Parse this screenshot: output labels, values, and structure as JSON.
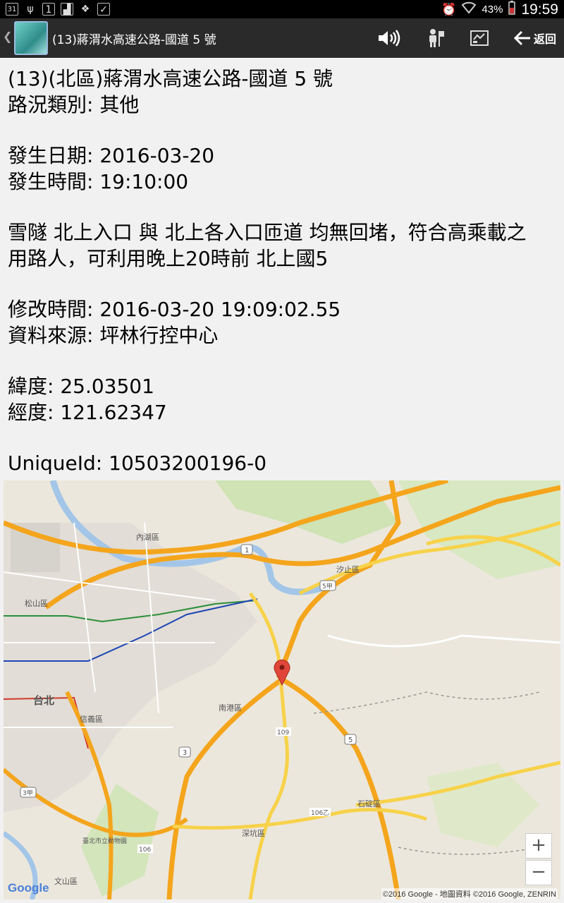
{
  "status_bar": {
    "battery_pct": "43%",
    "time": "19:59",
    "left_icons": [
      "calendar-icon",
      "usb-icon",
      "sim-icon",
      "image-icon",
      "dropbox-icon",
      "clipboard-icon"
    ],
    "calendar_day": "31",
    "sim_label": "1"
  },
  "action_bar": {
    "title": "(13)蔣渭水高速公路-國道 5 號",
    "back_label": "返回",
    "icons": [
      "volume-icon",
      "street-view-icon",
      "map-view-icon",
      "back-arrow-icon"
    ]
  },
  "detail": {
    "line_title": "(13)(北區)蔣渭水高速公路-國道 5 號",
    "category": "路況類別: 其他",
    "date": "發生日期: 2016-03-20",
    "time": "發生時間: 19:10:00",
    "desc_line1": "雪隧 北上入口 與 北上各入口匝道 均無回堵，符合高乘載之",
    "desc_line2": "用路人，可利用晚上20時前 北上國5",
    "modified": "修改時間: 2016-03-20 19:09:02.55",
    "source": "資料來源: 坪林行控中心",
    "lat": "緯度: 25.03501",
    "lng": "經度: 121.62347",
    "unique_id": "UniqueId: 10503200196-0"
  },
  "map": {
    "labels": {
      "neihu": "內湖區",
      "songshan": "松山區",
      "taipei": "台北",
      "xinyi": "信義區",
      "nangang": "南港區",
      "xizhi": "汐止區",
      "shenkeng": "深坑區",
      "shiding": "石碇區",
      "wenshan": "文山區",
      "zoo": "臺北市立動物園",
      "r1": "1",
      "r3": "3",
      "r5": "5",
      "r5b": "5甲",
      "r109": "109",
      "r106": "106",
      "r106b": "106乙",
      "r3b": "3甲"
    },
    "zoom_in": "+",
    "zoom_out": "−",
    "logo": "Google",
    "attribution": "©2016 Google - 地圖資料 ©2016 Google, ZENRIN",
    "colors": {
      "highway": "#f4a51c",
      "road": "#f7d24a",
      "land": "#ece7dc",
      "river": "#a3c6e8",
      "park": "#cfe3b5",
      "marker": "#e0463a"
    }
  }
}
